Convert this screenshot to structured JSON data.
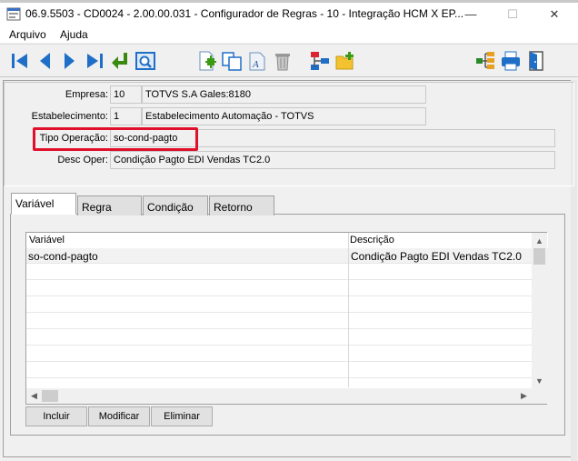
{
  "window": {
    "title": "06.9.5503 - CD0024 - 2.00.00.031 - Configurador de Regras - 10 - Integração HCM X EP...",
    "minimize": "—",
    "maximize": "☐",
    "close": "✕"
  },
  "menu": {
    "arquivo": "Arquivo",
    "ajuda": "Ajuda"
  },
  "toolbar": {
    "icons": [
      "first-record-icon",
      "previous-record-icon",
      "next-record-icon",
      "last-record-icon",
      "goto-return-icon",
      "search-view-icon",
      "new-record-icon",
      "copy-record-icon",
      "edit-record-icon",
      "delete-record-icon",
      "tree-swap-icon",
      "new-folder-icon",
      "hierarchy-icon",
      "print-icon",
      "exit-door-icon"
    ]
  },
  "form": {
    "empresa": {
      "label": "Empresa:",
      "code": "10",
      "name": "TOTVS S.A Gales:8180"
    },
    "estabelecimento": {
      "label": "Estabelecimento:",
      "code": "1",
      "name": "Estabelecimento Automação - TOTVS"
    },
    "tipo_operacao": {
      "label": "Tipo Operação:",
      "value": "so-cond-pagto"
    },
    "desc_oper": {
      "label": "Desc Oper:",
      "value": "Condição Pagto EDI Vendas TC2.0"
    }
  },
  "tabs": [
    "Variável",
    "Regra",
    "Condição",
    "Retorno"
  ],
  "grid": {
    "columns": [
      "Variável",
      "Descrição"
    ],
    "rows": [
      {
        "variavel": "so-cond-pagto",
        "descricao": "Condição Pagto EDI Vendas TC2.0"
      }
    ]
  },
  "buttons": {
    "incluir": "Incluir",
    "modificar": "Modificar",
    "eliminar": "Eliminar"
  },
  "colors": {
    "highlight": "#e0102a",
    "toolbar_blue": "#1f6fc8",
    "arrow_green": "#3a8a12"
  }
}
